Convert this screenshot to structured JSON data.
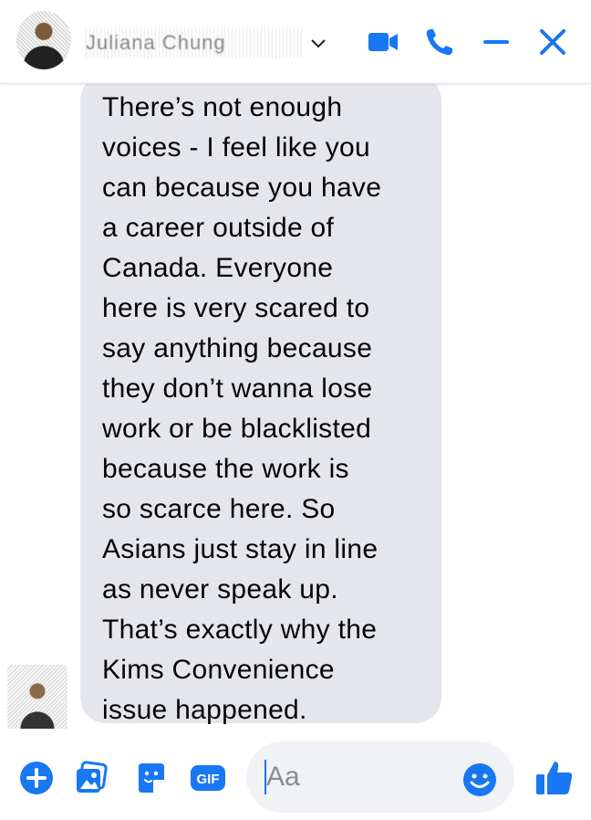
{
  "header": {
    "contact_name": "Juliana Chung",
    "icons": [
      "video-call-icon",
      "phone-call-icon",
      "minimize-icon",
      "close-icon"
    ]
  },
  "message": {
    "lines": [
      "There’s not enough",
      "voices - I feel like you",
      "can because you have",
      "a career outside of",
      "Canada. Everyone",
      "here is very scared to",
      "say anything because",
      "they don’t wanna lose",
      "work or be blacklisted",
      "because the work is",
      "so scarce here. So",
      "Asians just stay in line",
      "as never speak up.",
      "That’s exactly why the",
      "Kims Convenience",
      "issue happened."
    ]
  },
  "composer": {
    "placeholder": "Aa",
    "gif_label": "GIF",
    "icons": [
      "plus-icon",
      "photo-icon",
      "sticker-icon",
      "gif-icon",
      "emoji-icon",
      "like-icon"
    ]
  },
  "colors": {
    "accent": "#1877f2",
    "bubble": "#e4e6eb",
    "input_bg": "#f0f2f5"
  }
}
